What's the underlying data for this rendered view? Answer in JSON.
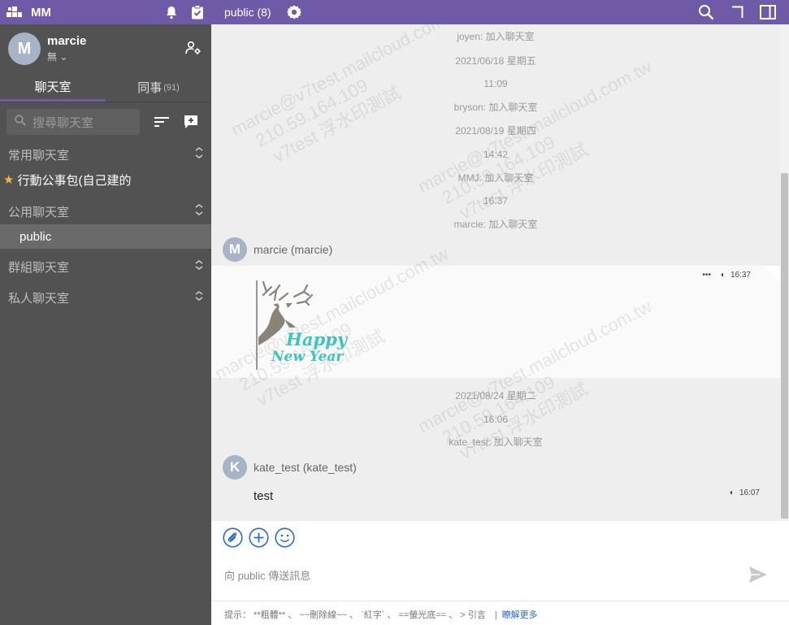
{
  "app": {
    "name": "MM"
  },
  "profile": {
    "avatar_letter": "M",
    "name": "marcie",
    "status": "無"
  },
  "tabs": [
    {
      "label": "聊天室",
      "count": ""
    },
    {
      "label": "同事",
      "count": "(91)"
    }
  ],
  "search": {
    "placeholder": "搜尋聊天室"
  },
  "sections": {
    "favorites": {
      "label": "常用聊天室",
      "rooms": [
        "行動公事包(自己建的"
      ]
    },
    "public": {
      "label": "公用聊天室",
      "rooms": [
        "public"
      ]
    },
    "groups": {
      "label": "群組聊天室"
    },
    "private": {
      "label": "私人聊天室"
    }
  },
  "header": {
    "room_title": "public (8)"
  },
  "messages": {
    "sys1": "joyen: 加入聊天室",
    "date1": "2021/06/18 星期五",
    "time1": "11:09",
    "sys2": "bryson: 加入聊天室",
    "date2": "2021/08/19 星期四",
    "time2": "14:42",
    "sys3": "MMJ: 加入聊天室",
    "time3": "16:37",
    "sys4": "marcie: 加入聊天室",
    "sender1": {
      "letter": "M",
      "name": "marcie (marcie)"
    },
    "image_msg": {
      "time": "16:37",
      "dots": "•••",
      "line1": "Happy",
      "line2": "New Year"
    },
    "date3": "2021/08/24 星期二",
    "time4": "16:06",
    "sys5": "kate_test: 加入聊天室",
    "sender2": {
      "letter": "K",
      "name": "kate_test (kate_test)"
    },
    "text_msg": {
      "text": "test",
      "time": "16:07"
    }
  },
  "watermark": {
    "l1": "marcie@v7test.mailcloud.com.tw",
    "l2": "210.59.164.109",
    "l3": "v7test 浮水印測試"
  },
  "composer": {
    "placeholder": "向 public 傳送訊息",
    "hint": "提示： **粗體** 、 ~~刪除線~~ 、 `紅字` 、 ==螢光底== 、 > 引言　|",
    "hint_more": "瞭解更多"
  },
  "colors": {
    "brand": "#6e5aa6",
    "sidebar": "#525252",
    "avatar": "#a7b3c6",
    "accent_blue": "#2a6cc8",
    "teal": "#3cc6c0"
  }
}
